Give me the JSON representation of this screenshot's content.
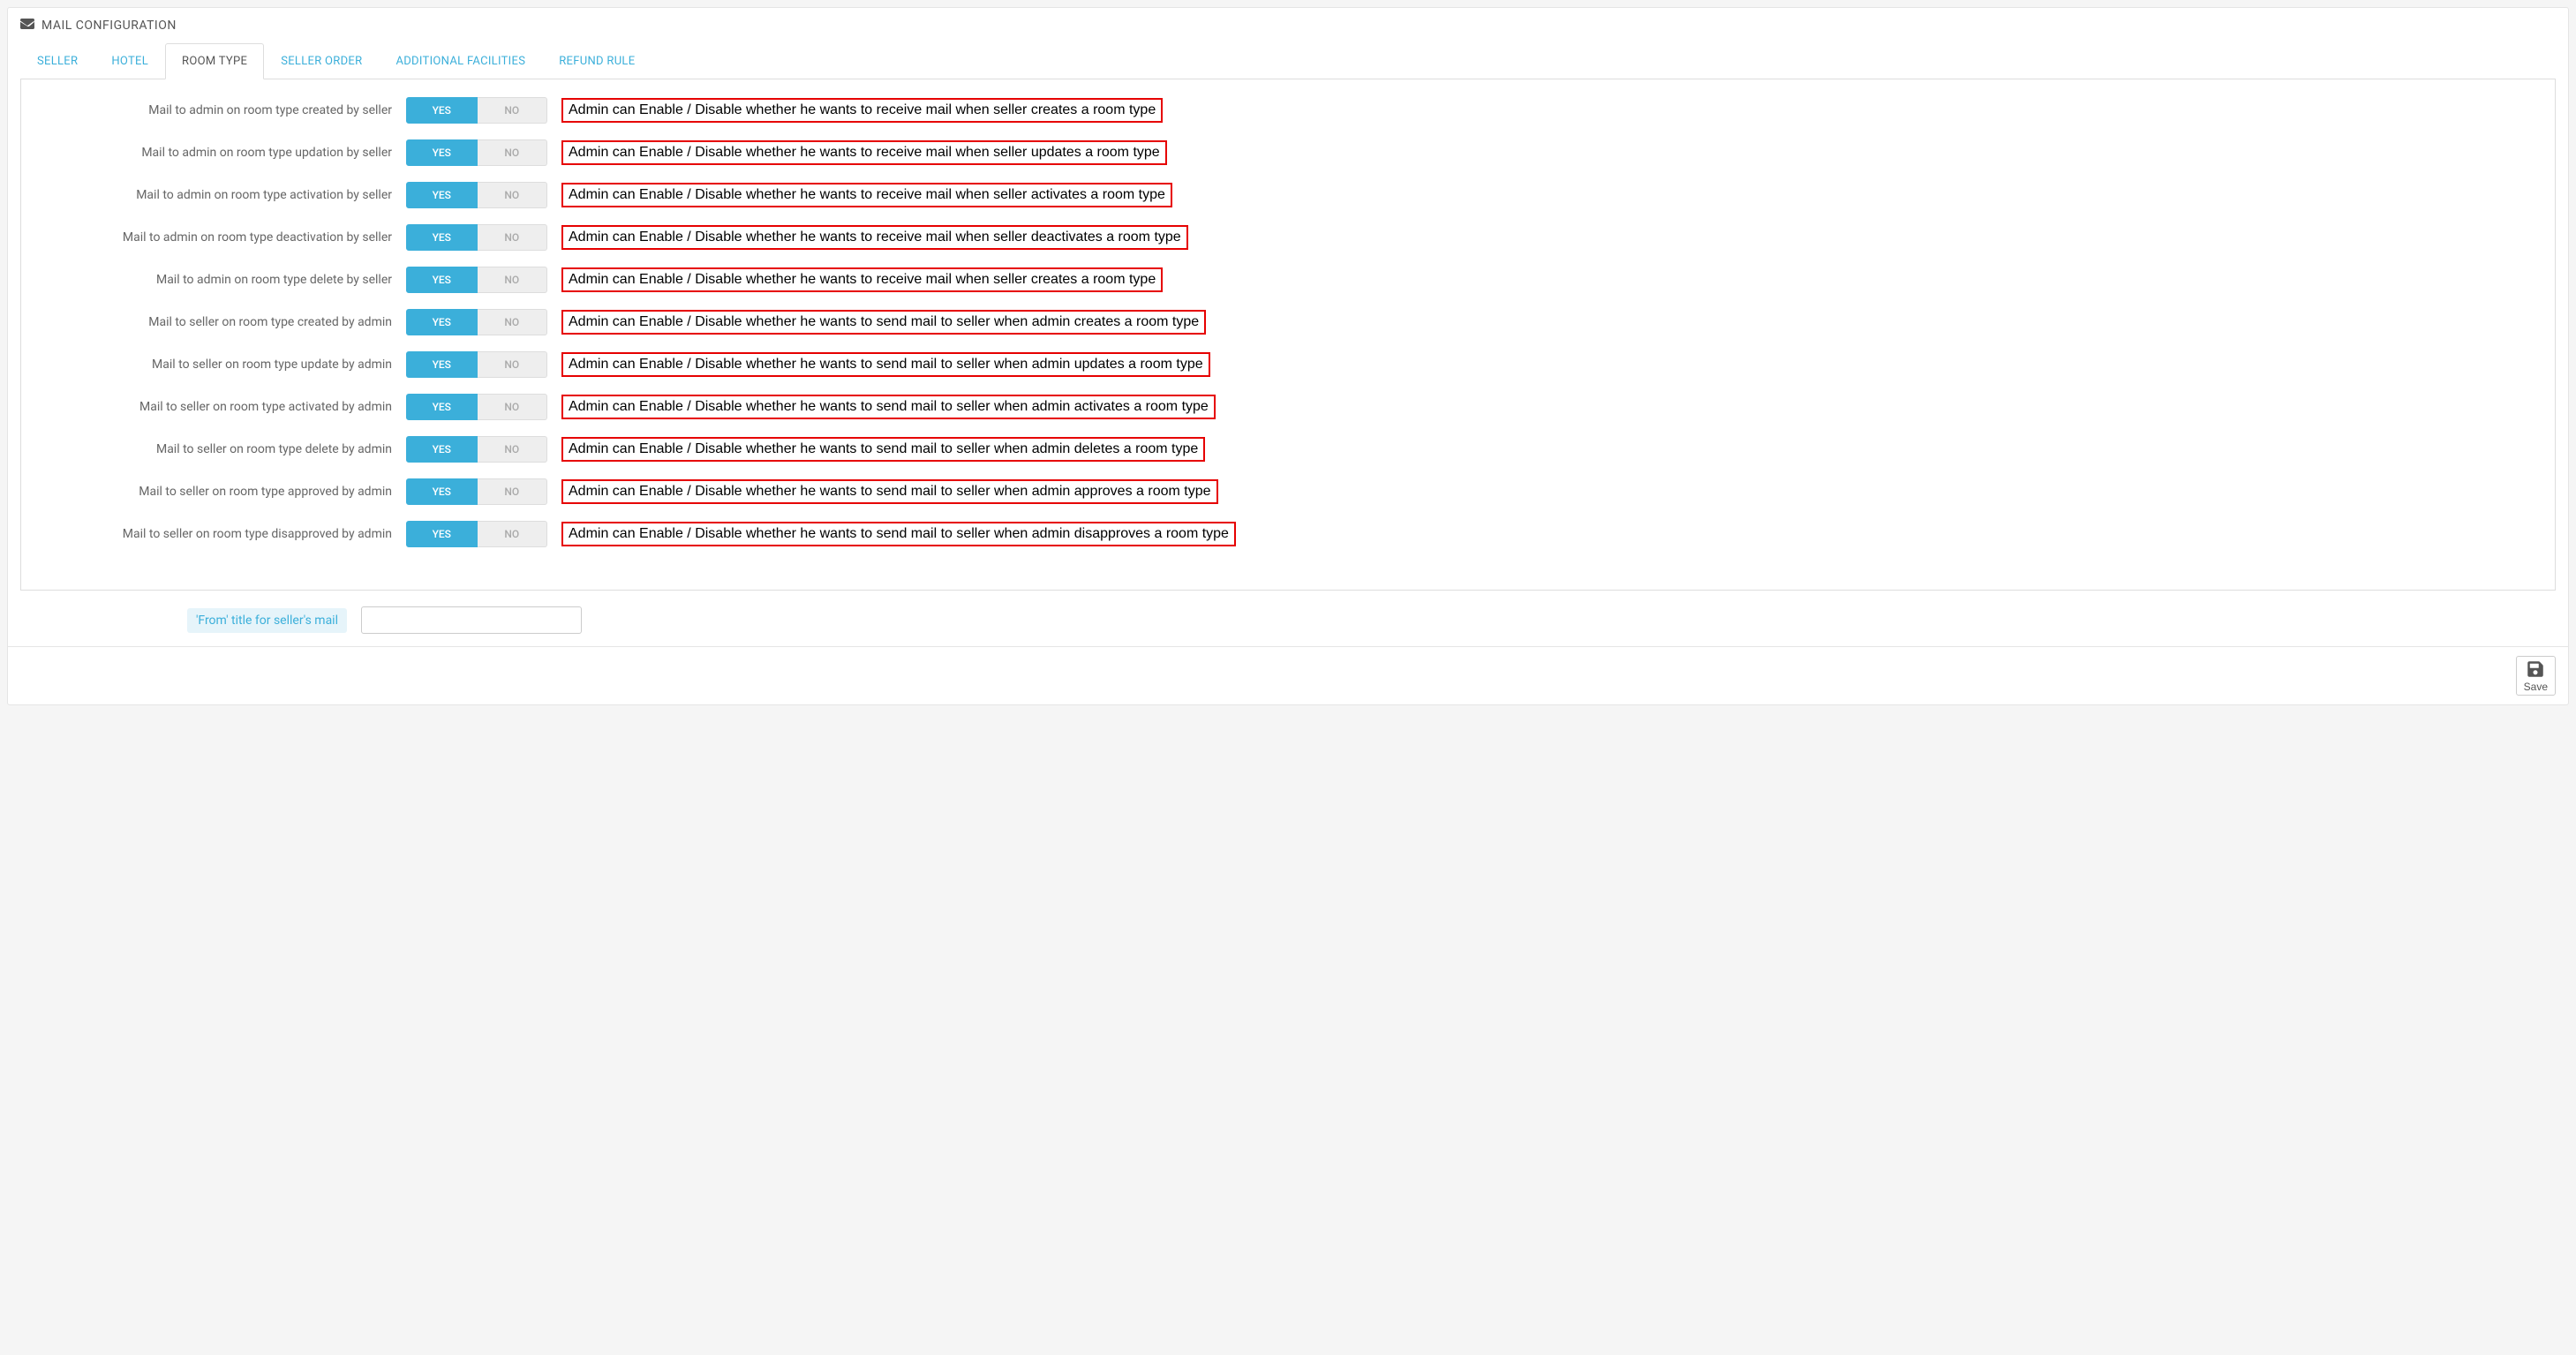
{
  "header": {
    "title": "MAIL CONFIGURATION"
  },
  "tabs": [
    {
      "label": "SELLER"
    },
    {
      "label": "HOTEL"
    },
    {
      "label": "ROOM TYPE"
    },
    {
      "label": "SELLER ORDER"
    },
    {
      "label": "ADDITIONAL FACILITIES"
    },
    {
      "label": "REFUND RULE"
    }
  ],
  "active_tab": "ROOM TYPE",
  "toggle": {
    "yes": "YES",
    "no": "NO"
  },
  "settings": [
    {
      "label": "Mail to admin on room type created by seller",
      "annotation": "Admin can Enable / Disable whether he wants to receive mail when seller creates a room type"
    },
    {
      "label": "Mail to admin on room type updation by seller",
      "annotation": "Admin can Enable / Disable whether he wants to receive mail when seller updates a room type"
    },
    {
      "label": "Mail to admin on room type activation by seller",
      "annotation": "Admin can Enable / Disable whether he wants to receive mail when seller activates a room type"
    },
    {
      "label": "Mail to admin on room type deactivation by seller",
      "annotation": "Admin can Enable / Disable whether he wants to receive mail when seller deactivates a room type"
    },
    {
      "label": "Mail to admin on room type delete by seller",
      "annotation": "Admin can Enable / Disable whether he wants to receive mail when seller creates a room type"
    },
    {
      "label": "Mail to seller on room type created by admin",
      "annotation": "Admin can Enable / Disable whether he wants to send mail to seller when admin creates a room type"
    },
    {
      "label": "Mail to seller on room type update by admin",
      "annotation": "Admin can Enable / Disable whether he wants to send mail to seller when admin updates a room type"
    },
    {
      "label": "Mail to seller on room type activated by admin",
      "annotation": "Admin can Enable / Disable whether he wants to send mail to seller when admin activates a room type"
    },
    {
      "label": "Mail to seller on room type delete by admin",
      "annotation": "Admin can Enable / Disable whether he wants to send mail to seller when admin deletes a room type"
    },
    {
      "label": "Mail to seller on room type approved by admin",
      "annotation": "Admin can Enable / Disable whether he wants to send mail to seller when admin approves a room type"
    },
    {
      "label": "Mail to seller on room type disapproved by admin",
      "annotation": "Admin can Enable / Disable whether he wants to send mail to seller when admin disapproves a room type"
    }
  ],
  "from_title": {
    "label": "'From' title for seller's mail",
    "value": ""
  },
  "footer": {
    "save": "Save"
  }
}
